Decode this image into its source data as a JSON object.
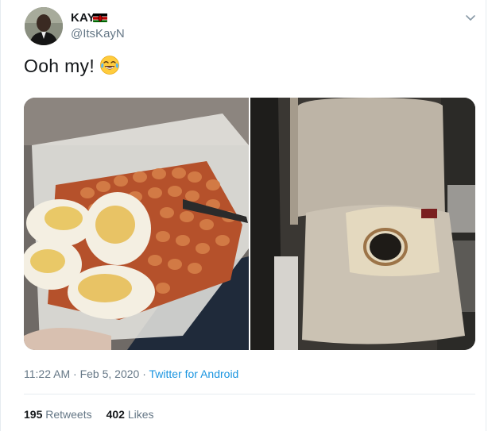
{
  "author": {
    "display_name": "KAY",
    "handle": "@ItsKayN"
  },
  "icons": {
    "flag": "kenya-flag-icon",
    "menu": "chevron-down-icon",
    "emoji": "face-with-tears-of-joy-icon"
  },
  "tweet": {
    "text": "Ooh my!",
    "media": [
      {
        "description_icon": "photo-baked-beans-eggs"
      },
      {
        "description_icon": "photo-burnt-car-seat"
      }
    ]
  },
  "meta": {
    "time": "11:22 AM",
    "separator": "·",
    "date": "Feb 5, 2020",
    "source": "Twitter for Android"
  },
  "stats": {
    "retweets_count": "195",
    "retweets_label": "Retweets",
    "likes_count": "402",
    "likes_label": "Likes"
  },
  "colors": {
    "link": "#1b95e0",
    "secondary_text": "#657786",
    "border": "#e6ecf0"
  }
}
